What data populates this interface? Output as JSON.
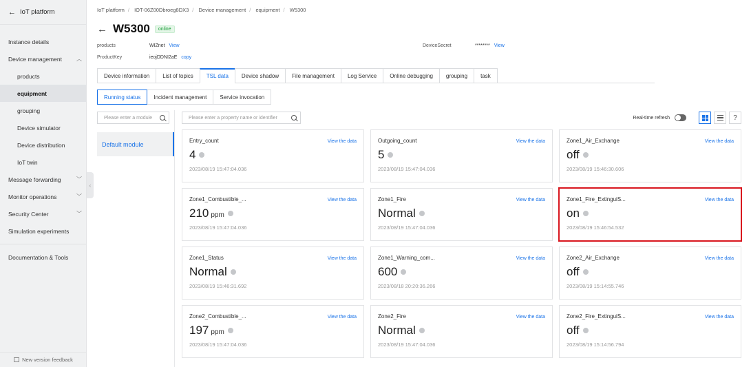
{
  "sidebar": {
    "header": "IoT platform",
    "items": [
      {
        "label": "Instance details",
        "type": "top",
        "chevron": ""
      },
      {
        "label": "Device management",
        "type": "top",
        "chevron": "up"
      },
      {
        "label": "products",
        "type": "sub",
        "chevron": ""
      },
      {
        "label": "equipment",
        "type": "sub-active",
        "chevron": ""
      },
      {
        "label": "grouping",
        "type": "sub",
        "chevron": ""
      },
      {
        "label": "Device simulator",
        "type": "sub",
        "chevron": ""
      },
      {
        "label": "Device distribution",
        "type": "sub",
        "chevron": ""
      },
      {
        "label": "IoT twin",
        "type": "sub",
        "chevron": ""
      },
      {
        "label": "Message forwarding",
        "type": "top",
        "chevron": "down"
      },
      {
        "label": "Monitor operations",
        "type": "top",
        "chevron": "down"
      },
      {
        "label": "Security Center",
        "type": "top",
        "chevron": "down"
      },
      {
        "label": "Simulation experiments",
        "type": "top",
        "chevron": ""
      },
      {
        "label": "Documentation & Tools",
        "type": "top-divided",
        "chevron": ""
      }
    ],
    "feedback": "New version feedback"
  },
  "breadcrumb": [
    "IoT platform",
    "IOT-06Z00Dbroeg8DX3",
    "Device management",
    "equipment",
    "W5300"
  ],
  "device": {
    "name": "W5300",
    "status": "online",
    "products_label": "products",
    "products_value": "WIZnet",
    "view_label": "View",
    "productkey_label": "ProductKey",
    "productkey_value": "ieojDDNI2aE",
    "copy_label": "copy",
    "secret_label": "DeviceSecret",
    "secret_value": "********"
  },
  "tabs": [
    {
      "label": "Device information",
      "active": false
    },
    {
      "label": "List of topics",
      "active": false
    },
    {
      "label": "TSL data",
      "active": true
    },
    {
      "label": "Device shadow",
      "active": false
    },
    {
      "label": "File management",
      "active": false
    },
    {
      "label": "Log Service",
      "active": false
    },
    {
      "label": "Online debugging",
      "active": false
    },
    {
      "label": "grouping",
      "active": false
    },
    {
      "label": "task",
      "active": false
    }
  ],
  "subtabs": [
    {
      "label": "Running status",
      "active": true
    },
    {
      "label": "Incident management",
      "active": false
    },
    {
      "label": "Service invocation",
      "active": false
    }
  ],
  "module_search_placeholder": "Please enter a module",
  "property_search_placeholder": "Please enter a property name or identifier",
  "default_module": "Default module",
  "realtime_refresh_label": "Real-time refresh",
  "help_label": "?",
  "view_data_label": "View the data",
  "cards": [
    {
      "name": "Entry_count",
      "value": "4",
      "unit": "",
      "time": "2023/08/19 15:47:04.036",
      "highlight": false
    },
    {
      "name": "Outgoing_count",
      "value": "5",
      "unit": "",
      "time": "2023/08/19 15:47:04.036",
      "highlight": false
    },
    {
      "name": "Zone1_Air_Exchange",
      "value": "off",
      "unit": "",
      "time": "2023/08/19 15:46:30.606",
      "highlight": false
    },
    {
      "name": "Zone1_Combustible_...",
      "value": "210",
      "unit": "ppm",
      "time": "2023/08/19 15:47:04.036",
      "highlight": false
    },
    {
      "name": "Zone1_Fire",
      "value": "Normal",
      "unit": "",
      "time": "2023/08/19 15:47:04.036",
      "highlight": false
    },
    {
      "name": "Zone1_Fire_ExtinguiS...",
      "value": "on",
      "unit": "",
      "time": "2023/08/19 15:46:54.532",
      "highlight": true
    },
    {
      "name": "Zone1_Status",
      "value": "Normal",
      "unit": "",
      "time": "2023/08/19 15:46:31.692",
      "highlight": false
    },
    {
      "name": "Zone1_Warning_com...",
      "value": "600",
      "unit": "",
      "time": "2023/08/18 20:20:36.266",
      "highlight": false
    },
    {
      "name": "Zone2_Air_Exchange",
      "value": "off",
      "unit": "",
      "time": "2023/08/19 15:14:55.746",
      "highlight": false
    },
    {
      "name": "Zone2_Combustible_...",
      "value": "197",
      "unit": "ppm",
      "time": "2023/08/19 15:47:04.036",
      "highlight": false
    },
    {
      "name": "Zone2_Fire",
      "value": "Normal",
      "unit": "",
      "time": "2023/08/19 15:47:04.036",
      "highlight": false
    },
    {
      "name": "Zone2_Fire_ExtinguiS...",
      "value": "off",
      "unit": "",
      "time": "2023/08/19 15:14:56.794",
      "highlight": false
    }
  ],
  "colors": {
    "accent": "#1a73e8",
    "highlight": "#d9171f",
    "online": "#1a9d3a"
  }
}
